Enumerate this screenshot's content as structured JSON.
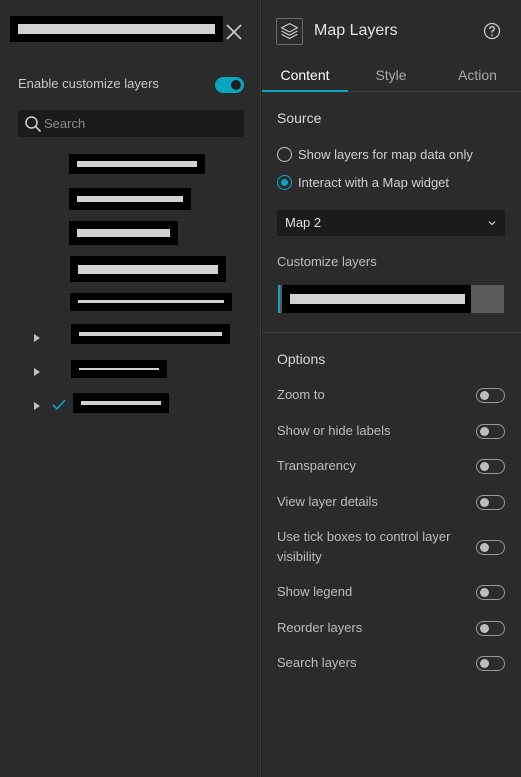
{
  "left_panel": {
    "enable_label": "Enable customize layers",
    "enable_on": true,
    "search_placeholder": "Search"
  },
  "right_panel": {
    "title": "Map Layers",
    "tabs": [
      {
        "label": "Content",
        "active": true
      },
      {
        "label": "Style",
        "active": false
      },
      {
        "label": "Action",
        "active": false
      }
    ],
    "source": {
      "title": "Source",
      "options": [
        {
          "label": "Show layers for map data only",
          "selected": false
        },
        {
          "label": "Interact with a Map widget",
          "selected": true
        }
      ]
    },
    "map_select": {
      "value": "Map 2"
    },
    "customize_label": "Customize layers",
    "options": {
      "title": "Options",
      "items": [
        {
          "label": "Zoom to",
          "on": false
        },
        {
          "label": "Show or hide labels",
          "on": false
        },
        {
          "label": "Transparency",
          "on": false
        },
        {
          "label": "View layer details",
          "on": false
        },
        {
          "label": "Use tick boxes to control layer visibility",
          "on": false
        },
        {
          "label": "Show legend",
          "on": false
        },
        {
          "label": "Reorder layers",
          "on": false
        },
        {
          "label": "Search layers",
          "on": false
        }
      ]
    }
  },
  "colors": {
    "accent": "#0aa6c0",
    "panel_bg": "#2b2b2b",
    "input_bg": "#1b1b1b"
  },
  "icons": {
    "close": "close-icon",
    "search": "search-icon",
    "layers": "layers-icon",
    "help": "help-icon",
    "caret": "caret-right-icon",
    "check": "check-icon",
    "chevron": "chevron-down-icon"
  }
}
